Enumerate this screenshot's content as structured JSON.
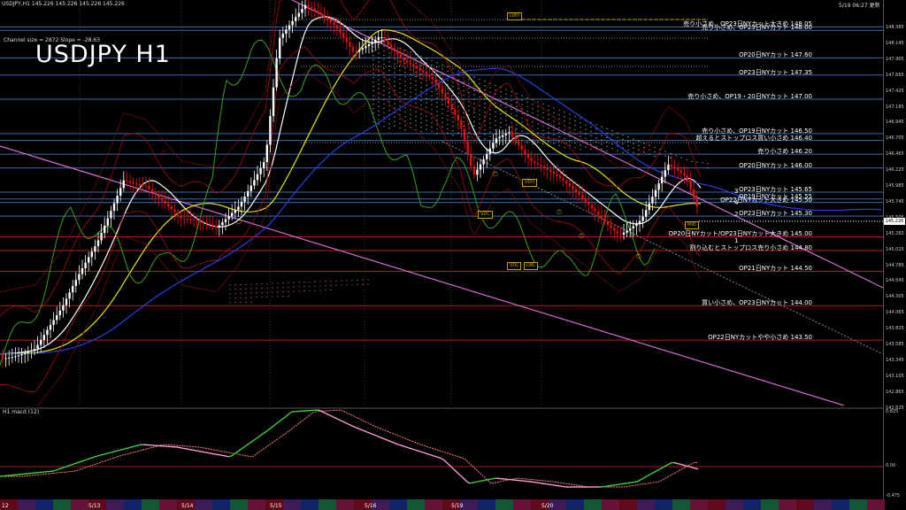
{
  "window": {
    "symbol_header": "USDJPY,H1  145.226 145.226 145.226 145.226",
    "channel_info": "Channel size = 2872  Slope = -28.63",
    "clock": "5/19 06:27 更新"
  },
  "chart_title": "USDJPY H1",
  "annotations": [
    {
      "text": "売り小さめ、OP23日NYカット大きめ 148.05",
      "price": 148.05
    },
    {
      "text": "売り小さめ、OP23日NYカット 148.00",
      "price": 148.0
    },
    {
      "text": "OP20日NYカット 147.60",
      "price": 147.6
    },
    {
      "text": "OP23日NYカット 147.35",
      "price": 147.35
    },
    {
      "text": "売り小さめ、OP19・20日NYカット 147.00",
      "price": 147.0
    },
    {
      "text": "売り小さめ、OP19日NYカット 146.50",
      "price": 146.5
    },
    {
      "text": "超えるとストップロス買い小さめ 146.40",
      "price": 146.4
    },
    {
      "text": "売り小さめ 146.20",
      "price": 146.2
    },
    {
      "text": "OP20日NYカット 146.00",
      "price": 146.0
    },
    {
      "text": "OP23日NYカット 145.65",
      "price": 145.65
    },
    {
      "text": "OP19日NYカット 145.55",
      "price": 145.55
    },
    {
      "text": "OP22日NYカット大きめ 145.50",
      "price": 145.5
    },
    {
      "text": "OP23日NYカット 145.30",
      "price": 145.3
    },
    {
      "text": "OP20日NYカット/OP23日NYカット大きめ 145.00",
      "price": 145.0
    },
    {
      "text": "割り込むとストップロス売り小さめ 144.80",
      "price": 144.8
    },
    {
      "text": "OP21日NYカット 144.50",
      "price": 144.5
    },
    {
      "text": "買い小さめ、OP23日NYカット 144.00",
      "price": 144.0
    },
    {
      "text": "OP22日NYカットやや小さめ 143.50",
      "price": 143.5
    }
  ],
  "price_axis": [
    "148.385",
    "148.145",
    "147.905",
    "147.665",
    "147.425",
    "147.185",
    "146.945",
    "146.705",
    "146.465",
    "146.225",
    "145.985",
    "145.745",
    "145.505",
    "145.265",
    "145.025",
    "144.785",
    "144.545",
    "144.305",
    "144.065",
    "143.825",
    "143.585",
    "143.345",
    "143.105",
    "142.865",
    "142.625"
  ],
  "current_price": "145.226",
  "time_axis": [
    "12",
    "5/13",
    "5/14",
    "5/15",
    "5/16",
    "5/19",
    "5/20"
  ],
  "subwindow": {
    "label": "H1  macd (12)",
    "axis_top": "0.825",
    "axis_zero": "0.00",
    "axis_bottom": "-0.475"
  },
  "tags": [
    "LWH",
    "VDC",
    "VDH",
    "VDL",
    "LWL",
    "MID",
    "3",
    "4",
    "1",
    "2"
  ],
  "colors": {
    "bg": "#000000",
    "ma_white": "#ffffff",
    "ma_yellow": "#e6e600",
    "ma_blue": "#2a3fe0",
    "ma_green": "#3aa01f",
    "channel": "#d070d0",
    "bear_candle": "#e01010",
    "bull_candle": "#ffffff",
    "macd": "#3fd040",
    "signal": "#ff8080"
  }
}
